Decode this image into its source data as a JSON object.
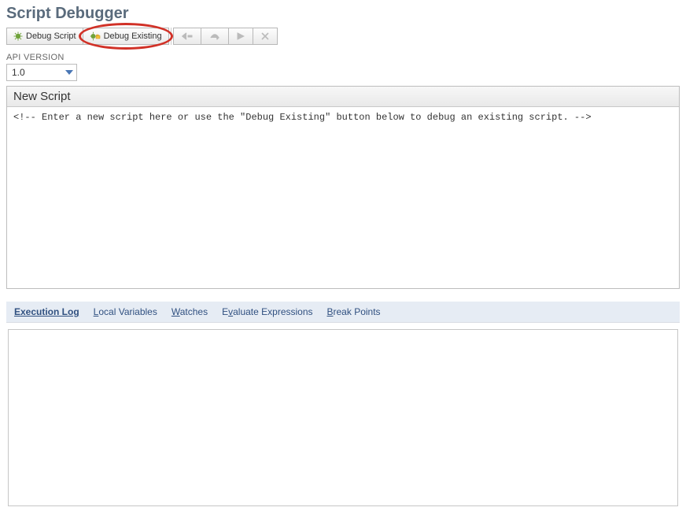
{
  "title": "Script Debugger",
  "toolbar": {
    "debug_script": "Debug Script",
    "debug_existing": "Debug Existing"
  },
  "api_version": {
    "label": "API VERSION",
    "value": "1.0"
  },
  "editor": {
    "title": "New Script",
    "content": "<!-- Enter a new script here or use the \"Debug Existing\" button below to debug an existing script. -->"
  },
  "tabs": {
    "execution_log": "Execution Log",
    "local_variables": "Local Variables",
    "watches": "Watches",
    "evaluate_expressions": "Evaluate Expressions",
    "break_points": "Break Points"
  }
}
